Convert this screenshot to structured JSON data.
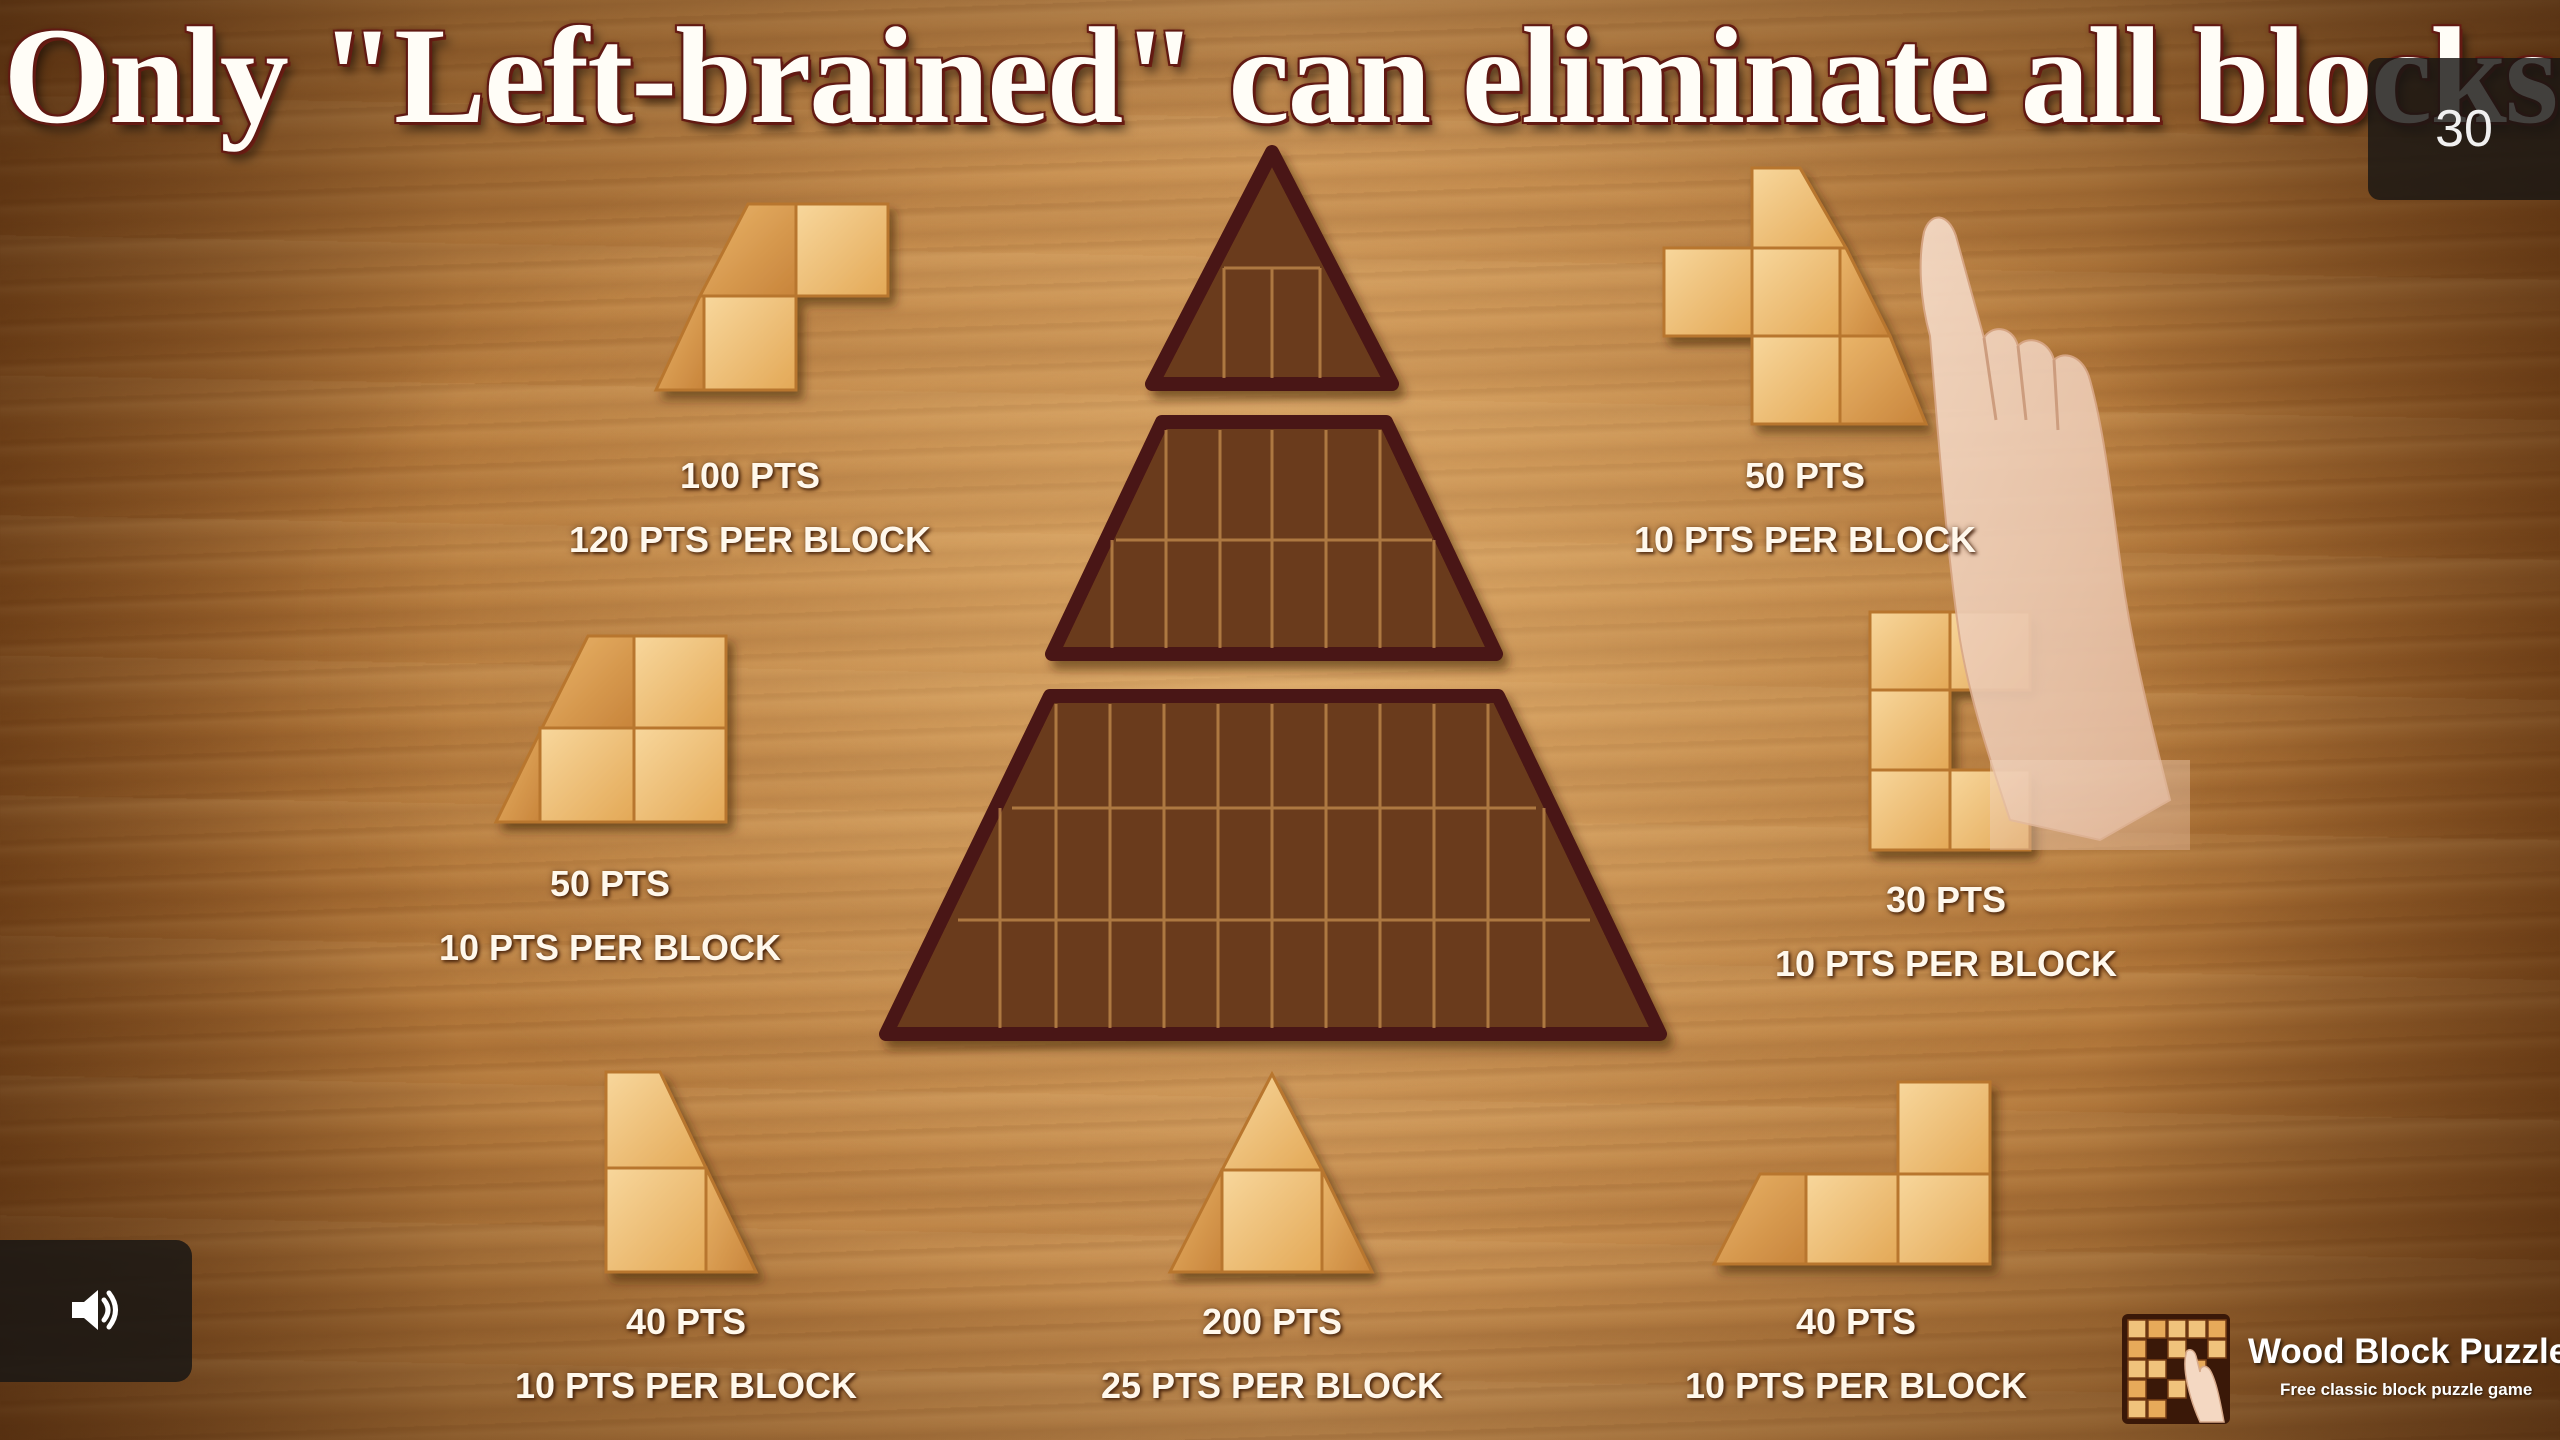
{
  "title": "Only \"Left-brained\" can eliminate all blocks",
  "timer": "30",
  "colors": {
    "block_light": "#f3c883",
    "block_dark": "#d9963f",
    "board_frame": "#4a1212",
    "board_fill": "#6b3b1c",
    "grid_line": "#c48d4e",
    "title_outline": "#6d1d14"
  },
  "pieces": [
    {
      "name": "piece-top-left",
      "points": "100 PTS",
      "per_block": "120 PTS PER BLOCK"
    },
    {
      "name": "piece-top-right",
      "points": "50 PTS",
      "per_block": "10 PTS PER BLOCK"
    },
    {
      "name": "piece-middle-left",
      "points": "50 PTS",
      "per_block": "10 PTS PER BLOCK"
    },
    {
      "name": "piece-middle-right",
      "points": "30 PTS",
      "per_block": "10 PTS PER BLOCK"
    },
    {
      "name": "piece-bottom-left",
      "points": "40 PTS",
      "per_block": "10 PTS PER BLOCK"
    },
    {
      "name": "piece-bottom-center",
      "points": "200 PTS",
      "per_block": "25 PTS PER BLOCK"
    },
    {
      "name": "piece-bottom-right",
      "points": "40 PTS",
      "per_block": "10 PTS PER BLOCK"
    }
  ],
  "icons": {
    "sound": "speaker-icon",
    "hand": "pointing-hand-icon",
    "brand_logo": "wood-block-puzzle-logo-icon"
  },
  "brand": {
    "name": "Wood Block Puzzle",
    "tagline": "Free classic block puzzle game"
  }
}
